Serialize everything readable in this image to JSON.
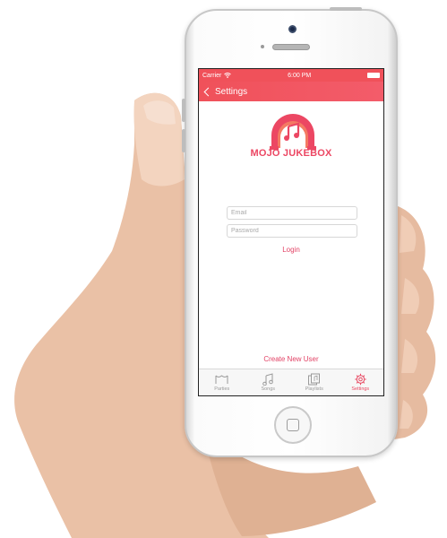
{
  "status_bar": {
    "carrier": "Carrier",
    "time": "6:00 PM"
  },
  "nav": {
    "back_label": "Settings"
  },
  "brand": {
    "logo_text": "MOJO JUKEBOX"
  },
  "login_form": {
    "email_placeholder": "Email",
    "password_placeholder": "Password",
    "login_label": "Login",
    "create_user_label": "Create New User"
  },
  "tabs": [
    {
      "label": "Parties",
      "icon": "parties-icon",
      "active": false
    },
    {
      "label": "Songs",
      "icon": "music-note-icon",
      "active": false
    },
    {
      "label": "Playlists",
      "icon": "playlists-icon",
      "active": false
    },
    {
      "label": "Settings",
      "icon": "gear-icon",
      "active": true
    }
  ],
  "colors": {
    "accent": "#f0515a",
    "brand_pink": "#e84a63"
  }
}
